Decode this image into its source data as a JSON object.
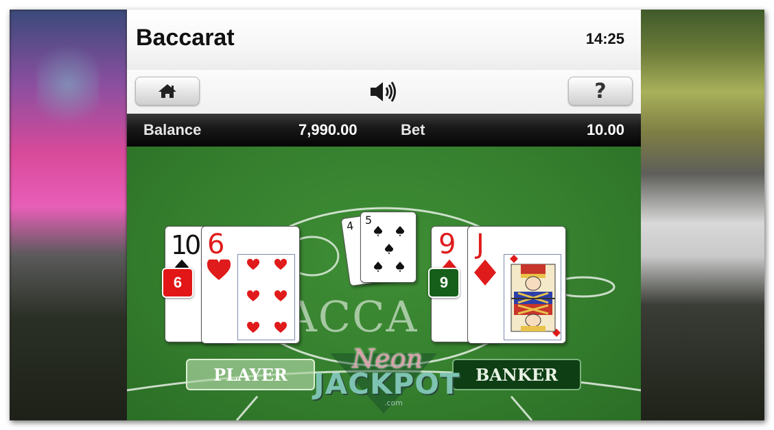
{
  "app": {
    "title": "Baccarat",
    "time": "14:25"
  },
  "toolbar": {
    "home_icon": "home-icon",
    "sound_icon": "speaker-icon",
    "help_label": "?"
  },
  "status": {
    "balance_label": "Balance",
    "balance_value": "7,990.00",
    "bet_label": "Bet",
    "bet_value": "10.00"
  },
  "table": {
    "table_text": "ACCA",
    "player_label": "PLAYER",
    "banker_label": "BANKER",
    "player_score": "6",
    "banker_score": "9"
  },
  "cards": {
    "player": [
      {
        "rank": "10",
        "suit": "spades"
      },
      {
        "rank": "6",
        "suit": "hearts"
      }
    ],
    "banker": [
      {
        "rank": "9",
        "suit": "diamonds"
      },
      {
        "rank": "J",
        "suit": "diamonds"
      }
    ],
    "shoe": [
      {
        "rank": "4",
        "suit": "spades"
      },
      {
        "rank": "5",
        "suit": "spades"
      }
    ]
  },
  "watermark": {
    "line1": "Neon",
    "line2": "JACKPOT",
    "line3": ".com"
  },
  "colors": {
    "felt": "#357f2e",
    "player_badge": "#e21616",
    "banker_badge": "#155f1a",
    "card_red": "#e01b1b"
  }
}
